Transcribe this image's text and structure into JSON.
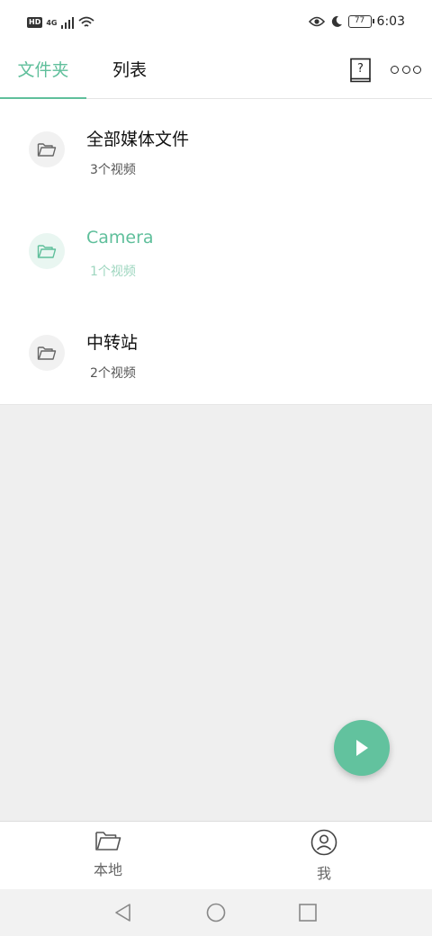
{
  "status_bar": {
    "network_badge": "HD",
    "network_type": "4G",
    "battery": "77",
    "time": "6:03",
    "icons": [
      "signal-icon",
      "wifi-icon",
      "eye-icon",
      "moon-icon",
      "battery-icon"
    ]
  },
  "tabs": [
    {
      "label": "文件夹",
      "active": true
    },
    {
      "label": "列表",
      "active": false
    }
  ],
  "header_actions": {
    "help_icon": "question-book-icon",
    "more_icon": "more-dots-icon"
  },
  "folders": [
    {
      "name": "全部媒体文件",
      "count": "3个视频",
      "active": false
    },
    {
      "name": "Camera",
      "count": "1个视频",
      "active": true
    },
    {
      "name": "中转站",
      "count": "2个视频",
      "active": false
    }
  ],
  "fab": {
    "icon": "play-icon"
  },
  "bottom_nav": [
    {
      "label": "本地",
      "icon": "folder-icon"
    },
    {
      "label": "我",
      "icon": "user-icon"
    }
  ],
  "colors": {
    "accent": "#5fbf9b",
    "fab": "#62c29e",
    "background": "#efefef"
  }
}
